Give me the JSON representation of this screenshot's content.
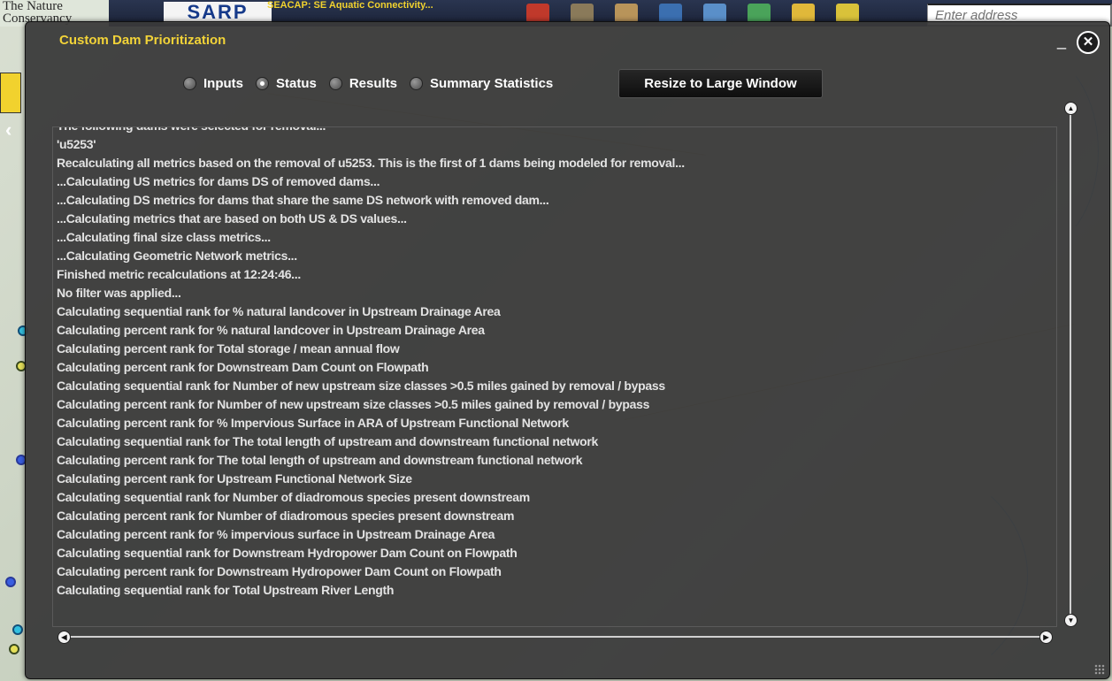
{
  "topbar": {
    "brand_text": "The Nature Conservancy",
    "sarp_logo": "SARP",
    "seacap_link": "SEACAP: SE Aquatic Connectivity...",
    "address_placeholder": "Enter address"
  },
  "dialog": {
    "title": "Custom Dam Prioritization",
    "minimize_label": "_",
    "close_label": "✕",
    "tabs": [
      {
        "label": "Inputs",
        "selected": false
      },
      {
        "label": "Status",
        "selected": true
      },
      {
        "label": "Results",
        "selected": false
      },
      {
        "label": "Summary Statistics",
        "selected": false
      }
    ],
    "resize_button": "Resize to Large Window",
    "log_partial_top": "The following dams were selected for removal...",
    "log_lines": [
      "'u5253'",
      "Recalculating all metrics based on the removal of u5253. This is the first of 1 dams being modeled for removal...",
      "...Calculating US metrics for dams DS of removed dams...",
      "...Calculating DS metrics for dams that share the same DS network with removed dam...",
      "...Calculating metrics that are based on both US & DS values...",
      "...Calculating final size class metrics...",
      "...Calculating Geometric Network metrics...",
      "Finished metric recalculations at 12:24:46...",
      "No filter was applied...",
      "Calculating sequential rank for % natural landcover in Upstream Drainage Area",
      "Calculating percent rank for % natural landcover in Upstream Drainage Area",
      "Calculating percent rank for Total storage / mean annual flow",
      "Calculating percent rank for Downstream Dam Count on Flowpath",
      "Calculating sequential rank for Number of new upstream size classes >0.5 miles gained by removal / bypass",
      "Calculating percent rank for Number of new upstream size classes >0.5 miles gained by removal / bypass",
      "Calculating percent rank for % Impervious Surface in ARA of Upstream Functional Network",
      "Calculating sequential rank for The total length of upstream and downstream functional network",
      "Calculating percent rank for The total length of upstream and downstream functional network",
      "Calculating percent rank for Upstream Functional Network Size",
      "Calculating sequential rank for Number of diadromous species present downstream",
      "Calculating percent rank for Number of diadromous species present downstream",
      "Calculating percent rank for % impervious surface in Upstream Drainage Area",
      "Calculating sequential rank for Downstream Hydropower Dam Count on Flowpath",
      "Calculating percent rank for Downstream Hydropower Dam Count on Flowpath",
      "Calculating sequential rank for Total Upstream River Length"
    ]
  },
  "colors": {
    "title_yellow": "#f2d338",
    "dialog_bg": "#3a3a3a",
    "log_text": "#e3e3e3"
  }
}
